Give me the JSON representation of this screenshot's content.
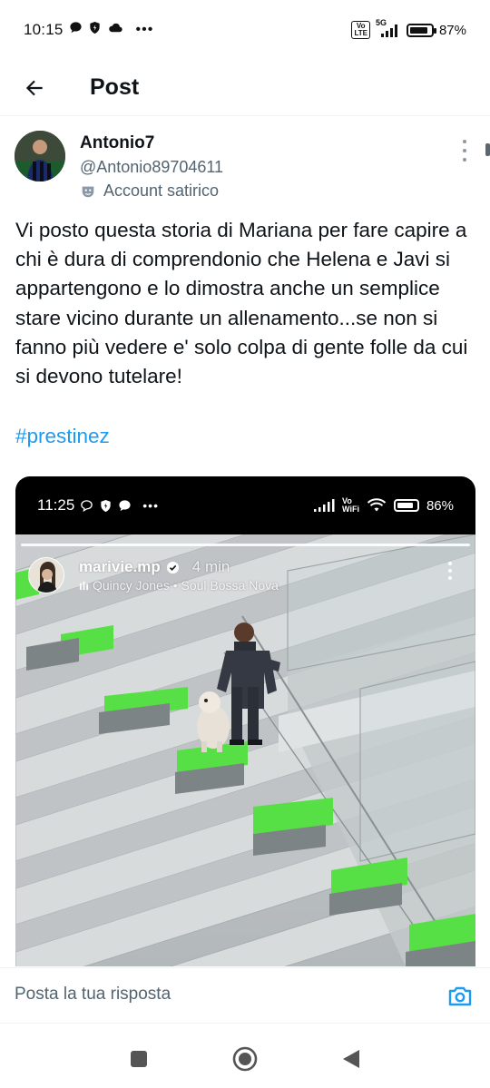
{
  "status_bar": {
    "time": "10:15",
    "network": "5G",
    "volte": "Vo\nLTE",
    "battery": "87%",
    "battery_level": 0.87
  },
  "header": {
    "title": "Post"
  },
  "author": {
    "name": "Antonio7",
    "handle": "@Antonio89704611",
    "label": "Account satirico"
  },
  "tweet": {
    "text": "Vi posto questa storia di Mariana per fare capire a chi è dura di comprendonio che Helena e Javi si appartengono e lo dimostra anche un semplice stare vicino durante un allenamento...se non si fanno più vedere e' solo colpa di gente folle da cui si devono tutelare!",
    "hashtag": "#prestinez"
  },
  "media": {
    "inner_status": {
      "time": "11:25",
      "wifi": "Vo\nWiFi",
      "battery": "86%",
      "battery_level": 0.86
    },
    "story": {
      "username": "marivie.mp",
      "time": "4 min",
      "music": "Quincy Jones • Soul Bossa Nova"
    }
  },
  "reply": {
    "placeholder": "Posta la tua risposta"
  },
  "colors": {
    "accent": "#1d9bf0",
    "secondary_text": "#536471",
    "stair_green": "#57e045"
  }
}
